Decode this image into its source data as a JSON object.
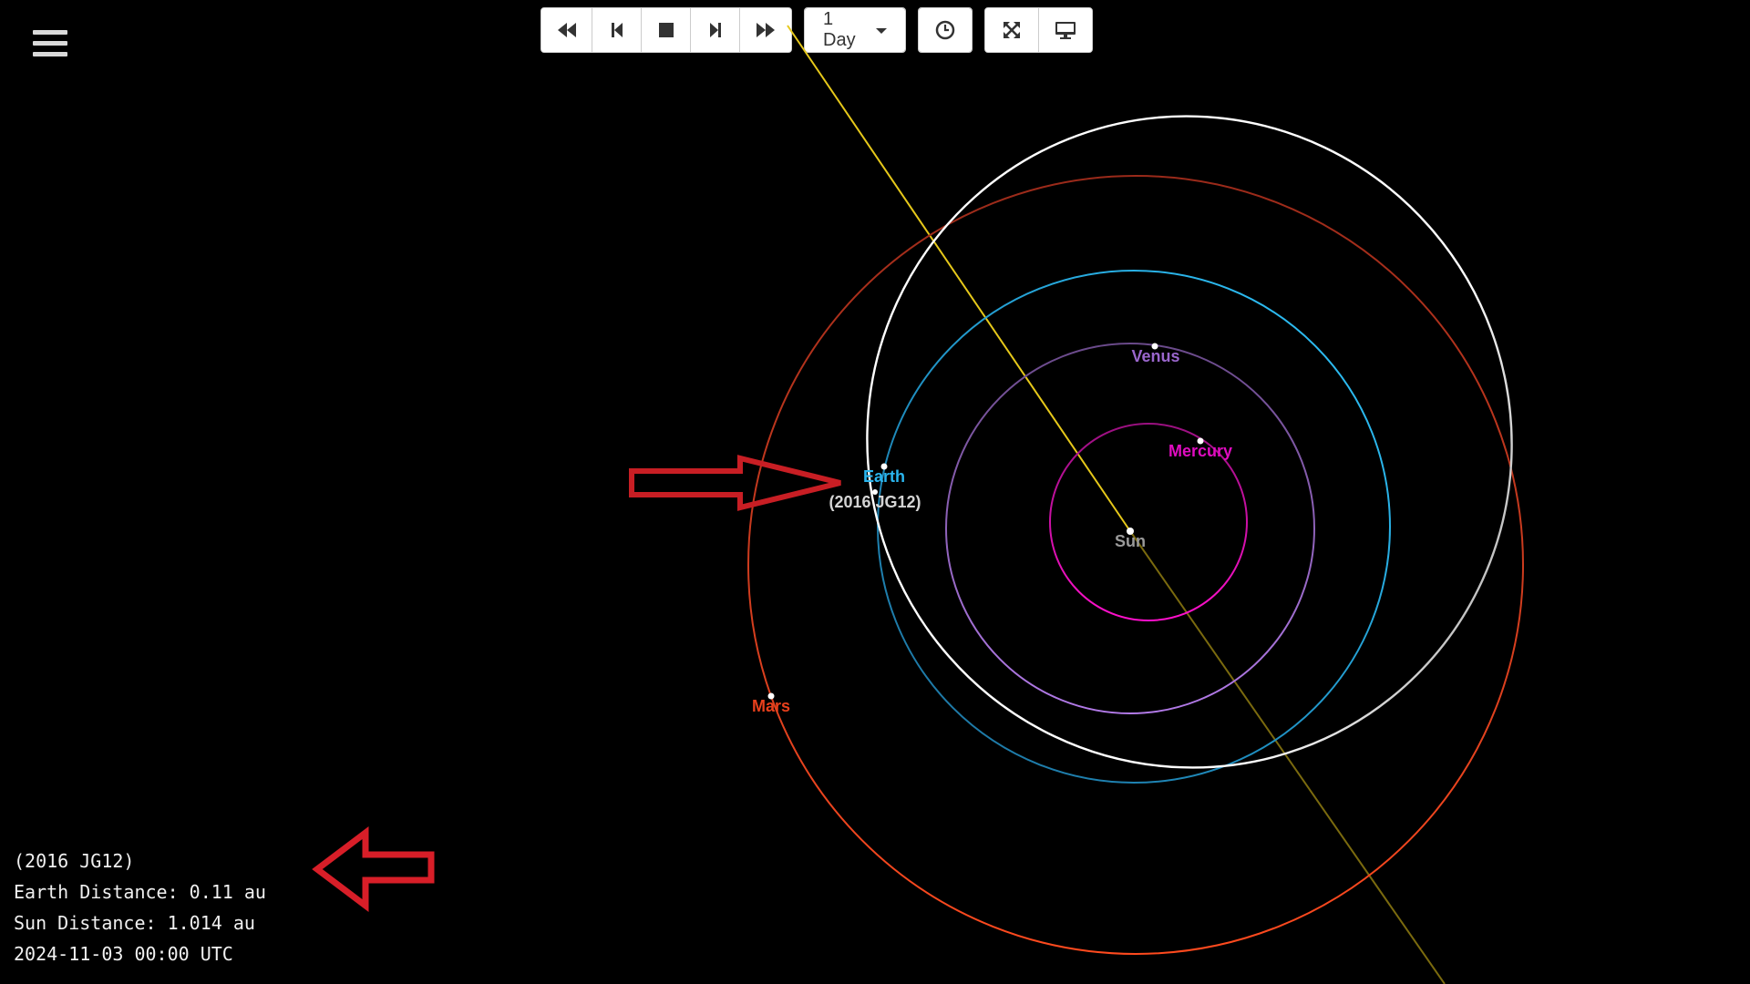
{
  "toolbar": {
    "speed_label": "1 Day",
    "buttons": [
      "fast-rewind-icon",
      "step-back-icon",
      "stop-icon",
      "step-forward-icon",
      "fast-forward-icon",
      "clock-icon",
      "fullscreen-icon",
      "monitor-icon"
    ]
  },
  "labels": {
    "sun": "Sun",
    "mercury": "Mercury",
    "venus": "Venus",
    "earth": "Earth",
    "mars": "Mars",
    "asteroid": "(2016 JG12)"
  },
  "colors": {
    "background": "#000000",
    "sun": "#aaaaaa",
    "mercury": "#e00cc0",
    "venus": "#9a66cc",
    "earth": "#2ab5ee",
    "mars": "#e8401c",
    "asteroid_orbit": "#ffffff",
    "asteroid_path": "#e6c81a",
    "annotation_arrows": "#d81e28"
  },
  "info": {
    "name": "(2016 JG12)",
    "earth_distance": "Earth Distance: 0.11 au",
    "sun_distance": "Sun Distance: 1.014 au",
    "datetime": "2024-11-03 00:00 UTC"
  }
}
